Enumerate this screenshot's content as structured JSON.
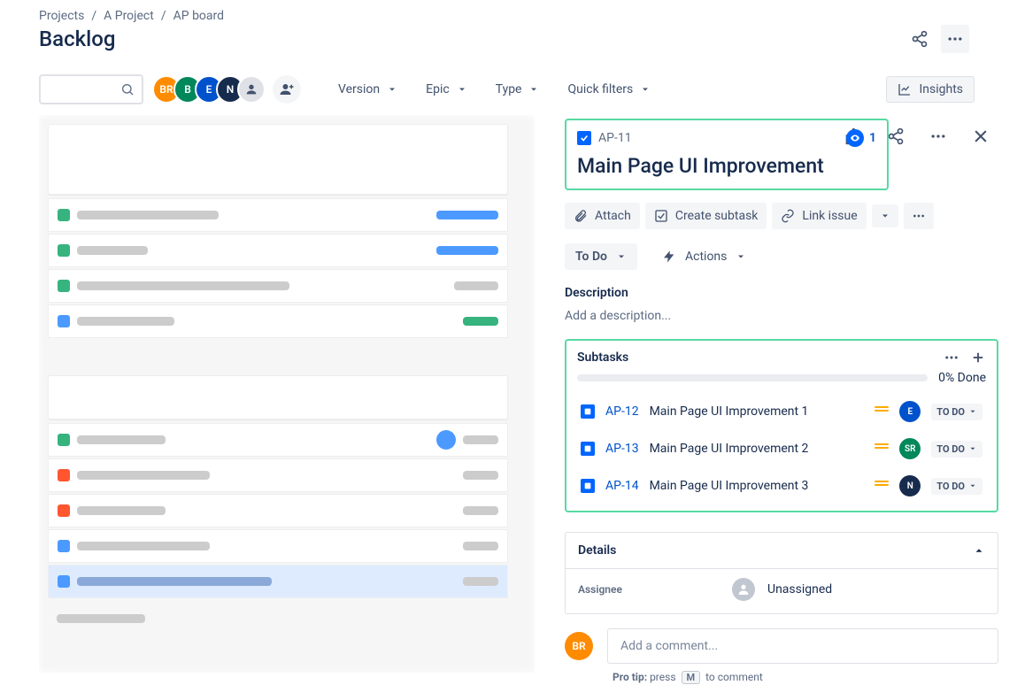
{
  "breadcrumb": {
    "projects": "Projects",
    "project": "A Project",
    "board": "AP board"
  },
  "page_title": "Backlog",
  "avatars": [
    "BR",
    "B",
    "E",
    "N"
  ],
  "dropdowns": {
    "version": "Version",
    "epic": "Epic",
    "type": "Type",
    "quickfilters": "Quick filters"
  },
  "insights": "Insights",
  "issue": {
    "key": "AP-11",
    "watchers": "1",
    "title": "Main Page UI Improvement",
    "attach": "Attach",
    "create_subtask": "Create subtask",
    "link_issue": "Link issue",
    "status": "To Do",
    "actions": "Actions",
    "description_label": "Description",
    "description_placeholder": "Add a description...",
    "subtasks_label": "Subtasks",
    "progress": "0% Done",
    "subtasks": [
      {
        "key": "AP-12",
        "title": "Main Page UI Improvement 1",
        "avatar": "E",
        "avatar_bg": "#0052CC",
        "status": "TO DO"
      },
      {
        "key": "AP-13",
        "title": "Main Page UI Improvement 2",
        "avatar": "SR",
        "avatar_bg": "#00875A",
        "status": "TO DO"
      },
      {
        "key": "AP-14",
        "title": "Main Page UI Improvement 3",
        "avatar": "N",
        "avatar_bg": "#172B4D",
        "status": "TO DO"
      }
    ],
    "details_label": "Details",
    "assignee_label": "Assignee",
    "assignee_value": "Unassigned",
    "comment_placeholder": "Add a comment...",
    "protip_prefix": "Pro tip:",
    "protip_press": "press",
    "protip_key": "M",
    "protip_suffix": "to comment"
  },
  "avatar_br": "BR"
}
